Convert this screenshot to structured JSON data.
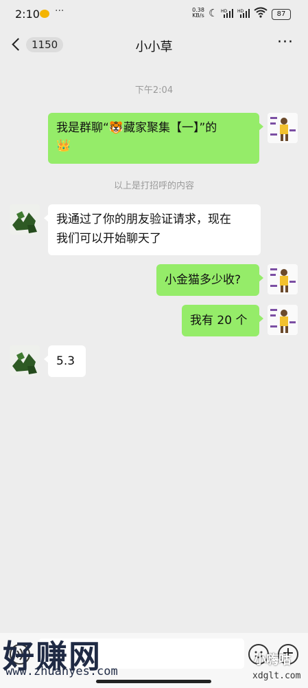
{
  "status_bar": {
    "time": "2:10",
    "dots": "···",
    "net_speed": "0.38",
    "net_unit": "KB/s",
    "signal_label_1": "HD",
    "signal_label_2": "HD",
    "battery": "87"
  },
  "header": {
    "unread_count": "1150",
    "title": "小小草",
    "more": "···"
  },
  "chat": {
    "timestamp": "下午2:04",
    "system_note": "以上是打招呼的内容",
    "messages": [
      {
        "sender": "me",
        "text_line1": "我是群聊“🐯藏家聚集【一】”的",
        "text_line2": "👑"
      },
      {
        "sender": "other",
        "text_line1": "我通过了你的朋友验证请求，现在",
        "text_line2": "我们可以开始聊天了"
      },
      {
        "sender": "me",
        "text": "小金猫多少收?"
      },
      {
        "sender": "me",
        "text": "我有 20 个"
      },
      {
        "sender": "other",
        "text": "5.3"
      }
    ]
  },
  "input": {
    "plus": "+"
  },
  "watermarks": {
    "left_title": "好赚网",
    "left_url": "www.zhuanyes.com",
    "right_title": "小嗨咕",
    "right_url": "xdglt.com"
  }
}
